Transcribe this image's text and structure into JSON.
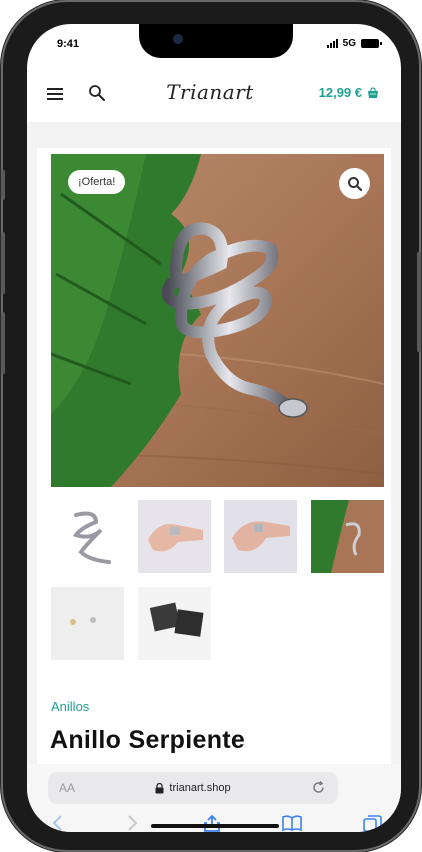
{
  "status_bar": {
    "time": "9:41",
    "network": "5G"
  },
  "header": {
    "logo_text": "Trianart",
    "cart_total": "12,99 €",
    "menu_icon": "hamburger-menu-icon",
    "search_icon": "search-icon",
    "cart_icon": "shopping-bag-icon"
  },
  "product": {
    "badge": "¡Oferta!",
    "category": "Anillos",
    "title": "Anillo Serpiente",
    "zoom_icon": "magnifier-icon"
  },
  "browser": {
    "text_size_label": "AA",
    "url": "trianart.shop",
    "lock_icon": "lock-icon",
    "reload_icon": "reload-icon"
  },
  "colors": {
    "accent": "#21a08f",
    "band": "#f2f3f2"
  }
}
